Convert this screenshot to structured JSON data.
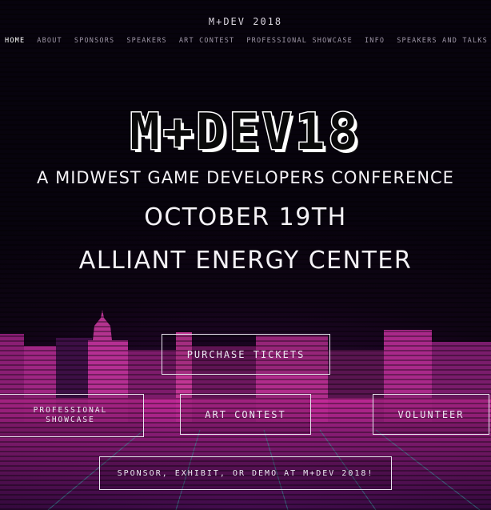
{
  "header": {
    "site_title": "M+DEV 2018"
  },
  "nav": {
    "items": [
      {
        "label": "HOME",
        "active": true
      },
      {
        "label": "ABOUT",
        "active": false
      },
      {
        "label": "SPONSORS",
        "active": false
      },
      {
        "label": "SPEAKERS",
        "active": false
      },
      {
        "label": "ART CONTEST",
        "active": false
      },
      {
        "label": "PROFESSIONAL SHOWCASE",
        "active": false
      },
      {
        "label": "INFO",
        "active": false
      },
      {
        "label": "SPEAKERS AND TALKS",
        "active": false
      }
    ]
  },
  "hero": {
    "logo_text": "M+DEV18",
    "tagline": "A MIDWEST GAME DEVELOPERS CONFERENCE",
    "date": "OCTOBER 19TH",
    "venue": "ALLIANT ENERGY CENTER"
  },
  "buttons": {
    "tickets": "PURCHASE TICKETS",
    "showcase_line1": "PROFESSIONAL",
    "showcase_line2": "SHOWCASE",
    "art_contest": "ART CONTEST",
    "volunteer": "VOLUNTEER",
    "sponsor": "SPONSOR, EXHIBIT, OR DEMO AT M+DEV 2018!"
  },
  "colors": {
    "background": "#07030d",
    "accent_magenta": "#b0258f",
    "text": "#f4f2f6"
  }
}
